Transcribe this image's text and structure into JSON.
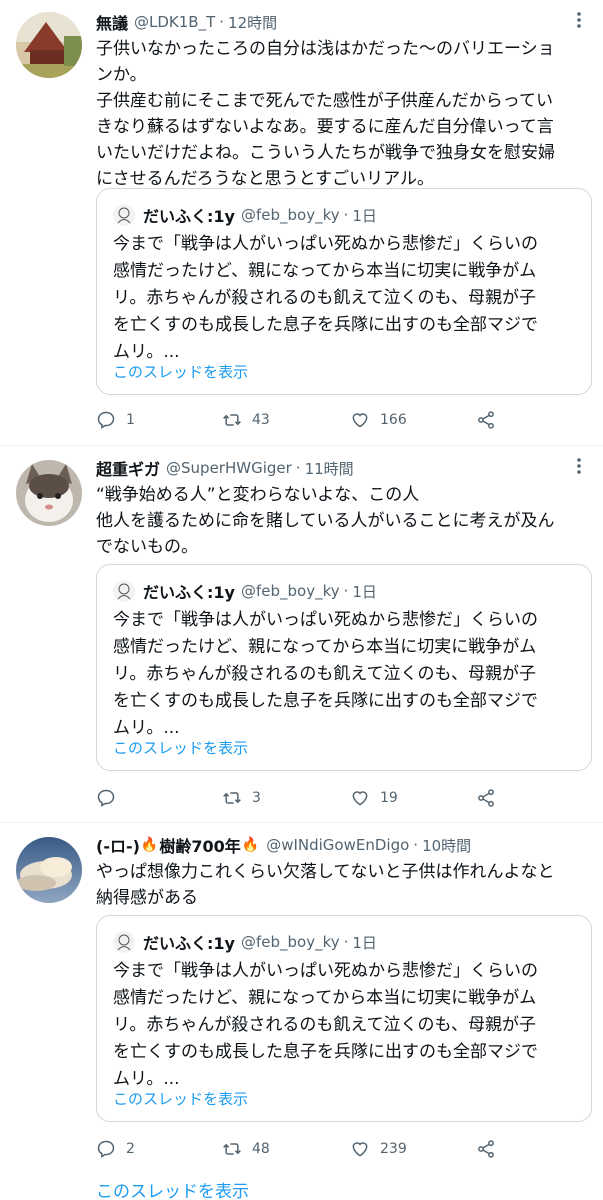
{
  "tweets": [
    {
      "name": "無議",
      "handle": "@LDK1B_T",
      "time": "12時間",
      "body": [
        "子供いなかったころの自分は浅はかだった〜のバリエーショ",
        "ンか。",
        "子供産む前にそこまで死んでた感性が子供産んだからってい",
        "きなり蘇るはずないよなあ。要するに産んだ自分偉いって言",
        "いたいだけだよね。こういう人たちが戦争で独身女を慰安婦",
        "にさせるんだろうなと思うとすごいリアル。"
      ],
      "quote": {
        "name": "だいふく:1y",
        "handle": "@feb_boy_ky",
        "time": "1日",
        "body": [
          "今まで「戦争は人がいっぱい死ぬから悲惨だ」くらいの",
          "感情だったけど、親になってから本当に切実に戦争がム",
          "リ。赤ちゃんが殺されるのも飢えて泣くのも、母親が子",
          "を亡くすのも成長した息子を兵隊に出すのも全部マジで",
          "ムリ。..."
        ],
        "thread_link": "このスレッドを表示"
      },
      "replies": "1",
      "retweets": "43",
      "likes": "166"
    },
    {
      "name": "超重ギガ",
      "handle": "@SuperHWGiger",
      "time": "11時間",
      "body": [
        "“戦争始める人”と変わらないよな、この人",
        "他人を護るために命を賭している人がいることに考えが及ん",
        "でないもの。"
      ],
      "quote": {
        "name": "だいふく:1y",
        "handle": "@feb_boy_ky",
        "time": "1日",
        "body": [
          "今まで「戦争は人がいっぱい死ぬから悲惨だ」くらいの",
          "感情だったけど、親になってから本当に切実に戦争がム",
          "リ。赤ちゃんが殺されるのも飢えて泣くのも、母親が子",
          "を亡くすのも成長した息子を兵隊に出すのも全部マジで",
          "ムリ。..."
        ],
        "thread_link": "このスレッドを表示"
      },
      "replies": "",
      "retweets": "3",
      "likes": "19"
    },
    {
      "name_prefix": "(-ロ-)",
      "name_main": "樹齢700年",
      "handle": "@wINdiGowEnDigo",
      "time": "10時間",
      "body": [
        "やっぱ想像力これくらい欠落してないと子供は作れんよなと",
        "納得感がある"
      ],
      "quote": {
        "name": "だいふく:1y",
        "handle": "@feb_boy_ky",
        "time": "1日",
        "body": [
          "今まで「戦争は人がいっぱい死ぬから悲惨だ」くらいの",
          "感情だったけど、親になってから本当に切実に戦争がム",
          "リ。赤ちゃんが殺されるのも飢えて泣くのも、母親が子",
          "を亡くすのも成長した息子を兵隊に出すのも全部マジで",
          "ムリ。..."
        ],
        "thread_link": "このスレッドを表示"
      },
      "replies": "2",
      "retweets": "48",
      "likes": "239"
    }
  ],
  "show_thread": "このスレッドを表示",
  "dot": "·",
  "icons": {
    "more": "more-icon",
    "reply": "reply-icon",
    "retweet": "retweet-icon",
    "like": "like-icon",
    "share": "share-icon",
    "flame": "flame-icon"
  },
  "colors": {
    "link": "#1d9bf0",
    "secondary": "#536471",
    "border": "#cfd9de",
    "divider": "#eff3f4"
  }
}
